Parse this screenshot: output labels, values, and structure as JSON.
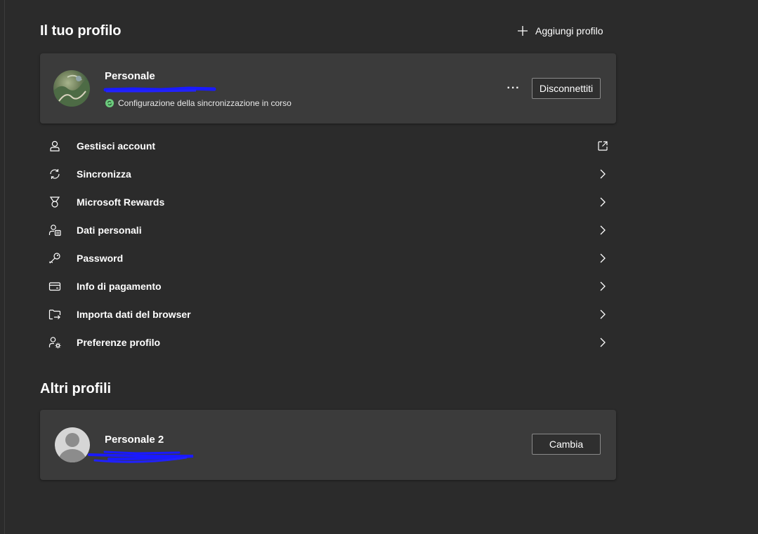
{
  "your_profile": {
    "title": "Il tuo profilo",
    "add_profile_label": "Aggiungi profilo"
  },
  "current_profile": {
    "name": "Personale",
    "sync_status": "Configurazione della sincronizzazione in corso",
    "more_label": "···",
    "disconnect_label": "Disconnettiti"
  },
  "menu": {
    "items": [
      {
        "label": "Gestisci account",
        "icon": "person-icon",
        "trail": "external-link-icon"
      },
      {
        "label": "Sincronizza",
        "icon": "sync-icon",
        "trail": "chevron-right-icon"
      },
      {
        "label": "Microsoft Rewards",
        "icon": "medal-icon",
        "trail": "chevron-right-icon"
      },
      {
        "label": "Dati personali",
        "icon": "personal-info-icon",
        "trail": "chevron-right-icon"
      },
      {
        "label": "Password",
        "icon": "key-icon",
        "trail": "chevron-right-icon"
      },
      {
        "label": "Info di pagamento",
        "icon": "credit-card-icon",
        "trail": "chevron-right-icon"
      },
      {
        "label": "Importa dati del browser",
        "icon": "import-icon",
        "trail": "chevron-right-icon"
      },
      {
        "label": "Preferenze profilo",
        "icon": "profile-settings-icon",
        "trail": "chevron-right-icon"
      }
    ]
  },
  "other_profiles": {
    "title": "Altri profili",
    "profiles": [
      {
        "name": "Personale 2",
        "switch_label": "Cambia"
      }
    ]
  },
  "colors": {
    "background": "#2b2b2b",
    "card": "#3b3b3b",
    "sync_ok": "#6ccb7d",
    "redaction": "#1a1aff"
  }
}
